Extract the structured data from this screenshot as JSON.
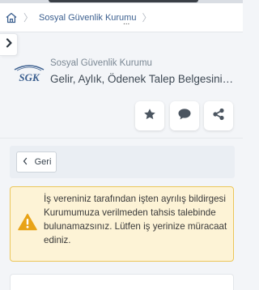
{
  "breadcrumb": {
    "items": [
      {
        "label": "Sosyal Güvenlik Kurumu"
      }
    ],
    "overflow": "..."
  },
  "header": {
    "logo_text": "SGK",
    "institution": "Sosyal Güvenlik Kurumu",
    "title": "Gelir, Aylık, Ödenek Talep Belgesinin Ve..."
  },
  "actions": {
    "favorite_icon": "star-icon",
    "comment_icon": "speech-bubble-icon",
    "share_icon": "share-icon"
  },
  "navigation": {
    "back_label": "Geri"
  },
  "alert": {
    "type": "warning",
    "icon": "warning-icon",
    "message": "İş vereniniz tarafından işten ayrılış bildirgesi Kurumumuza verilmeden tahsis talebinde bulunamazsınız. Lütfen iş yerinize müracaat ediniz."
  },
  "colors": {
    "brand": "#3b5f8f",
    "warning_bg": "#fdf3d6",
    "warning_border": "#ecc75a",
    "warning_icon": "#e8a317"
  }
}
